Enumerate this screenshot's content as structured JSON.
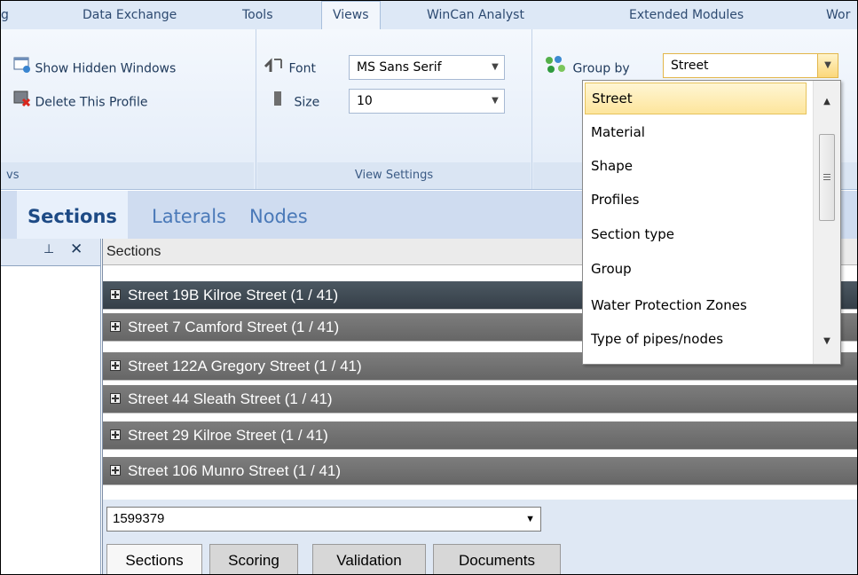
{
  "ribbon_tabs": [
    {
      "label": "g"
    },
    {
      "label": "Data Exchange"
    },
    {
      "label": "Tools"
    },
    {
      "label": "Views"
    },
    {
      "label": "WinCan Analyst"
    },
    {
      "label": "Extended Modules"
    },
    {
      "label": "Wor"
    }
  ],
  "ribbon": {
    "show_hidden_windows": "Show Hidden Windows",
    "delete_profile": "Delete This Profile",
    "group1_label": "vs",
    "font_label": "Font",
    "font_value": "MS Sans Serif",
    "size_label": "Size",
    "size_value": "10",
    "view_settings_label": "View Settings",
    "group_by_label": "Group by",
    "group_by_value": "Street"
  },
  "doc_tabs": [
    {
      "label": "Sections"
    },
    {
      "label": "Laterals"
    },
    {
      "label": "Nodes"
    }
  ],
  "left_pane": {
    "pin_icon": "pin-icon",
    "close_icon": "close-icon"
  },
  "sections": {
    "header": "Sections",
    "rows": [
      "Street 19B Kilroe Street (1 / 41)",
      "Street 7 Camford Street (1 / 41)",
      "Street 122A Gregory Street (1 / 41)",
      "Street 44 Sleath Street (1 / 41)",
      "Street 29 Kilroe Street (1 / 41)",
      "Street 106 Munro Street (1 / 41)"
    ],
    "id_value": "1599379",
    "bottom_tabs": [
      "Sections",
      "Scoring",
      "Validation",
      "Documents"
    ]
  },
  "dropdown": {
    "items": [
      "Street",
      "Material",
      "Shape",
      "Profiles",
      "Section type",
      "Group",
      "Water Protection Zones",
      "Type of pipes/nodes"
    ],
    "selected": "Street"
  },
  "colors": {
    "ribbon_bg": "#e3ecf8",
    "selected_item": "#fde59c",
    "section_row_dark": "#3d4851",
    "section_row": "#707070"
  }
}
